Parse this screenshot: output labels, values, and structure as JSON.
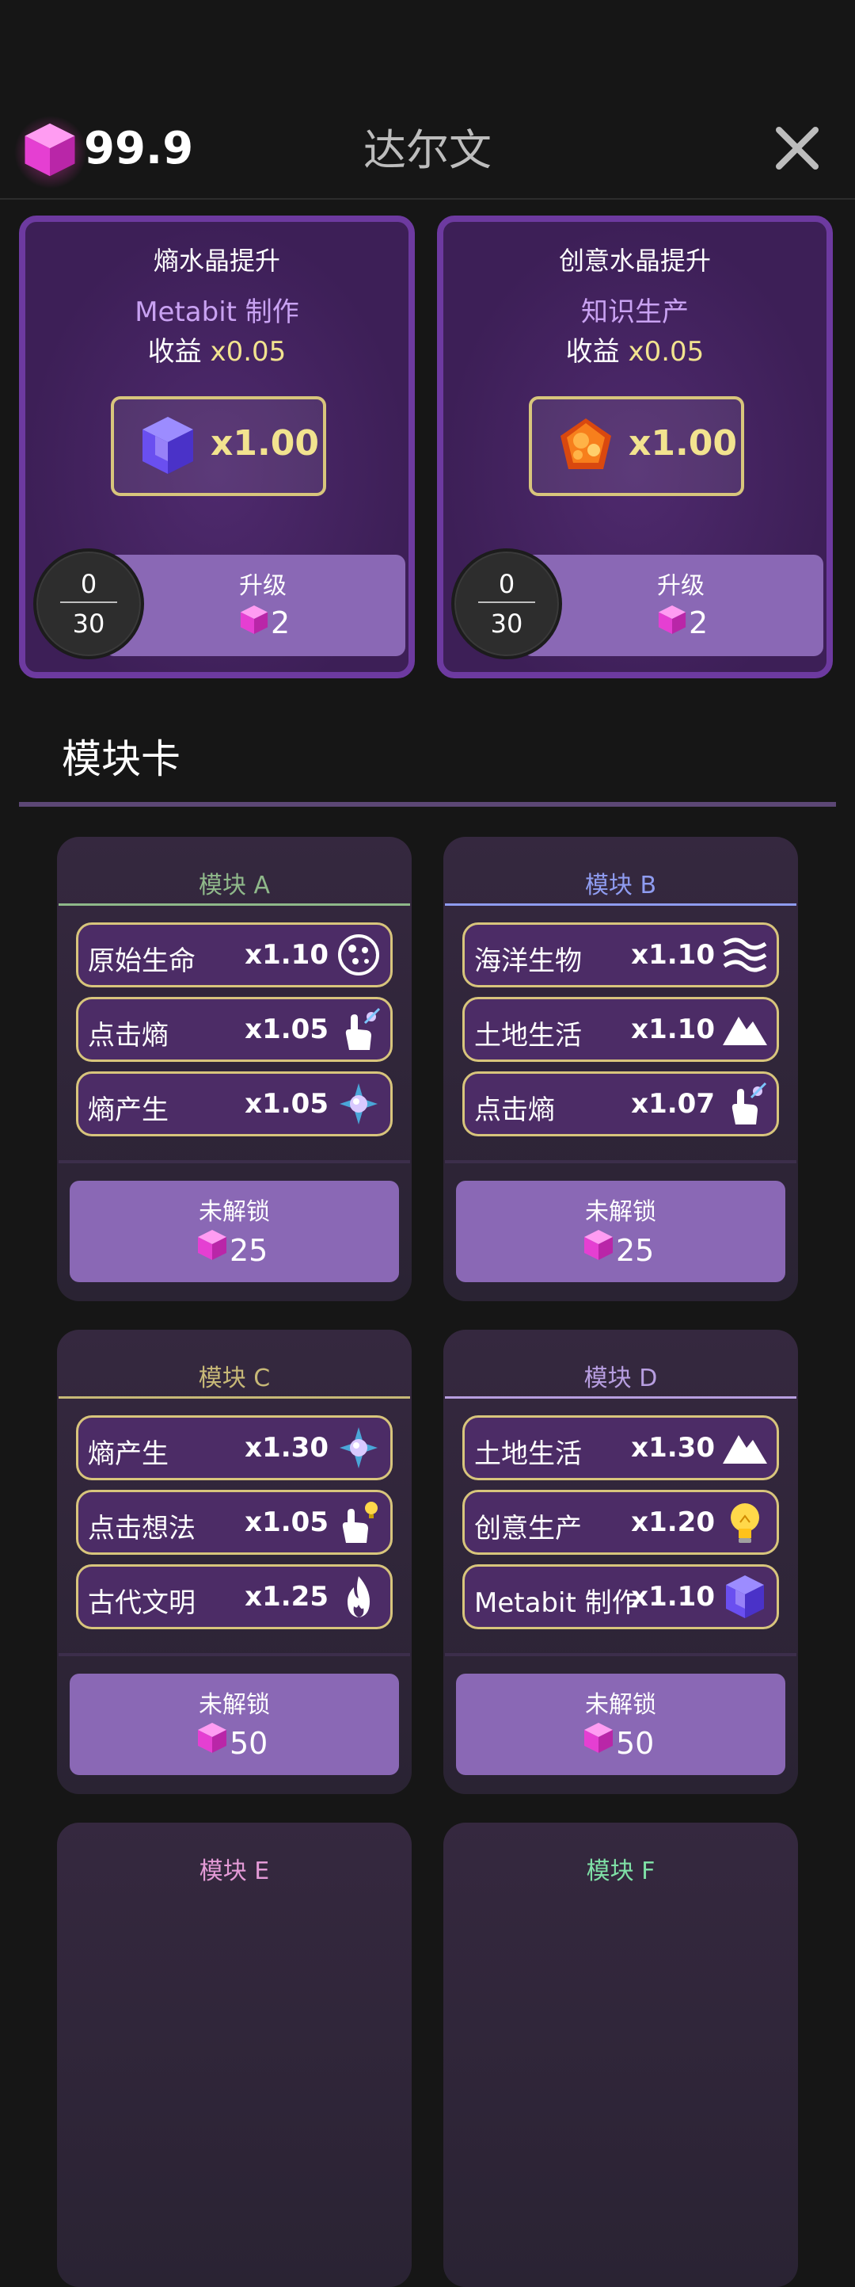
{
  "header": {
    "gem_value": "99.9",
    "title": "达尔文"
  },
  "upgrades": [
    {
      "title": "熵水晶提升",
      "subtitle": "Metabit 制作",
      "yield_label": "收益",
      "yield_mult": "x0.05",
      "multiplier": "x1.00",
      "progress_current": "0",
      "progress_max": "30",
      "button_label": "升级",
      "cost": "2",
      "icon": "purple-crystal-icon"
    },
    {
      "title": "创意水晶提升",
      "subtitle": "知识生产",
      "yield_label": "收益",
      "yield_mult": "x0.05",
      "multiplier": "x1.00",
      "progress_current": "0",
      "progress_max": "30",
      "button_label": "升级",
      "cost": "2",
      "icon": "orange-crystal-icon"
    }
  ],
  "section_title": "模块卡",
  "modules": [
    {
      "name": "模块 A",
      "color": "#8fb88a",
      "rows": [
        {
          "name": "原始生命",
          "mult": "x1.10",
          "icon": "cell-icon"
        },
        {
          "name": "点击熵",
          "mult": "x1.05",
          "icon": "tap-entropy-icon"
        },
        {
          "name": "熵产生",
          "mult": "x1.05",
          "icon": "entropy-orb-icon"
        }
      ],
      "button_label": "未解锁",
      "cost": "25"
    },
    {
      "name": "模块 B",
      "color": "#8f9cf0",
      "rows": [
        {
          "name": "海洋生物",
          "mult": "x1.10",
          "icon": "waves-icon"
        },
        {
          "name": "土地生活",
          "mult": "x1.10",
          "icon": "mountain-icon"
        },
        {
          "name": "点击熵",
          "mult": "x1.07",
          "icon": "tap-entropy-icon"
        }
      ],
      "button_label": "未解锁",
      "cost": "25"
    },
    {
      "name": "模块 C",
      "color": "#c7b877",
      "rows": [
        {
          "name": "熵产生",
          "mult": "x1.30",
          "icon": "entropy-orb-icon"
        },
        {
          "name": "点击想法",
          "mult": "x1.05",
          "icon": "tap-idea-icon"
        },
        {
          "name": "古代文明",
          "mult": "x1.25",
          "icon": "fire-icon"
        }
      ],
      "button_label": "未解锁",
      "cost": "50"
    },
    {
      "name": "模块 D",
      "color": "#b79ee0",
      "rows": [
        {
          "name": "土地生活",
          "mult": "x1.30",
          "icon": "mountain-icon"
        },
        {
          "name": "创意生产",
          "mult": "x1.20",
          "icon": "lightbulb-icon"
        },
        {
          "name": "Metabit 制作",
          "mult": "x1.10",
          "icon": "purple-crystal-icon"
        }
      ],
      "button_label": "未解锁",
      "cost": "50"
    },
    {
      "name": "模块 E",
      "color": "#e39ad6"
    },
    {
      "name": "模块 F",
      "color": "#7fe0a6"
    }
  ]
}
